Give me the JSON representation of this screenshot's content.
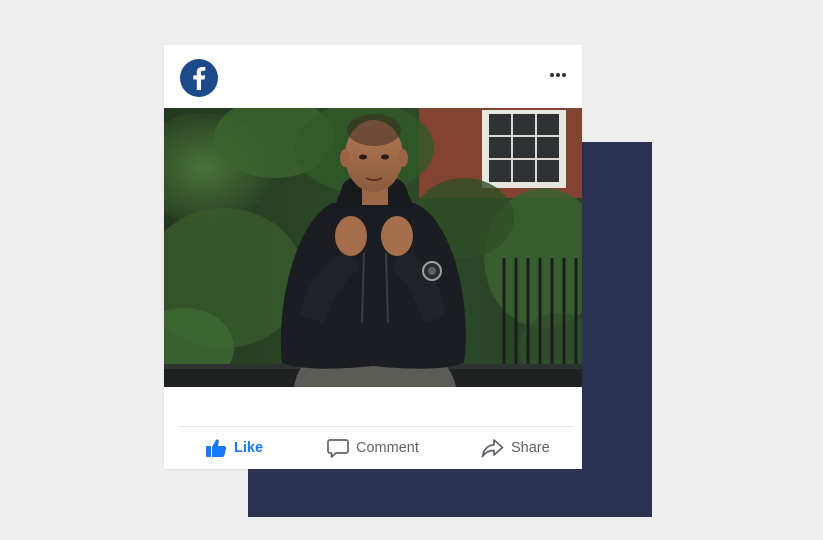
{
  "post": {
    "brand_icon": "facebook-logo-icon",
    "menu_icon": "more-options-icon",
    "photo_description_icon": "post-photo",
    "actions": {
      "like": {
        "label": "Like",
        "icon": "thumbs-up-icon"
      },
      "comment": {
        "label": "Comment",
        "icon": "speech-bubble-icon"
      },
      "share": {
        "label": "Share",
        "icon": "share-arrow-icon"
      }
    }
  },
  "colors": {
    "page_background": "#eeeeee",
    "backdrop": "#2b3251",
    "card": "#ffffff",
    "facebook_blue": "#1877f2",
    "logo_navy": "#1c4a8b",
    "muted_text": "#5f6368"
  }
}
